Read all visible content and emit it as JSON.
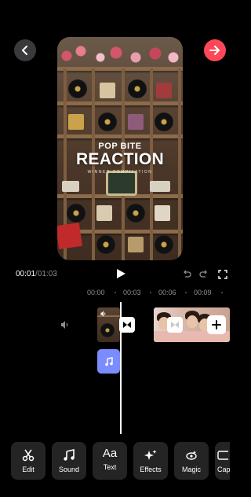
{
  "preview": {
    "title_small": "POP BITE",
    "title_big": "REACTION",
    "subtitle": "WINNER COMPILATION"
  },
  "playback": {
    "current_time": "00:01",
    "total_time": "01:03"
  },
  "ruler": {
    "labels": [
      "00:00",
      "00:03",
      "00:06",
      "00:09"
    ]
  },
  "toolbar": {
    "items": [
      {
        "label": "Edit",
        "icon": "scissors-icon"
      },
      {
        "label": "Sound",
        "icon": "music-note-icon"
      },
      {
        "label": "Text",
        "icon": "text-aa-icon",
        "glyph": "Aa"
      },
      {
        "label": "Effects",
        "icon": "sparkle-icon"
      },
      {
        "label": "Magic",
        "icon": "magic-icon"
      },
      {
        "label": "Cap",
        "icon": "captions-icon"
      }
    ]
  },
  "colors": {
    "background": "#000000",
    "next_button": "#ff4757",
    "audio_clip": "#7b8cff",
    "tool_background": "#242424"
  }
}
